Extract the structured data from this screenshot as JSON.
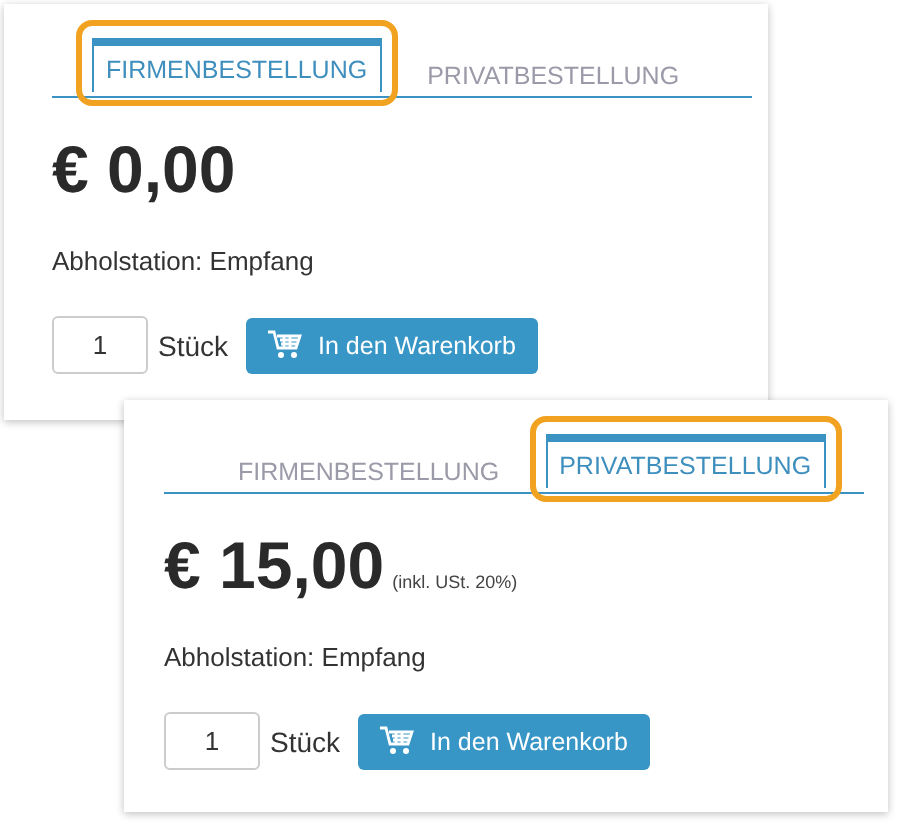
{
  "cards": [
    {
      "tabs": [
        {
          "label": "FIRMENBESTELLUNG",
          "selected": true
        },
        {
          "label": "PRIVATBESTELLUNG",
          "selected": false
        }
      ],
      "price": "€ 0,00",
      "pickup": "Abholstation: Empfang",
      "quantity": "1",
      "unit": "Stück",
      "button": "In den Warenkorb"
    },
    {
      "tabs": [
        {
          "label": "FIRMENBESTELLUNG",
          "selected": false
        },
        {
          "label": "PRIVATBESTELLUNG",
          "selected": true
        }
      ],
      "price": "€ 15,00",
      "tax_note": "(inkl. USt. 20%)",
      "pickup": "Abholstation: Empfang",
      "quantity": "1",
      "unit": "Stück",
      "button": "In den Warenkorb"
    }
  ]
}
